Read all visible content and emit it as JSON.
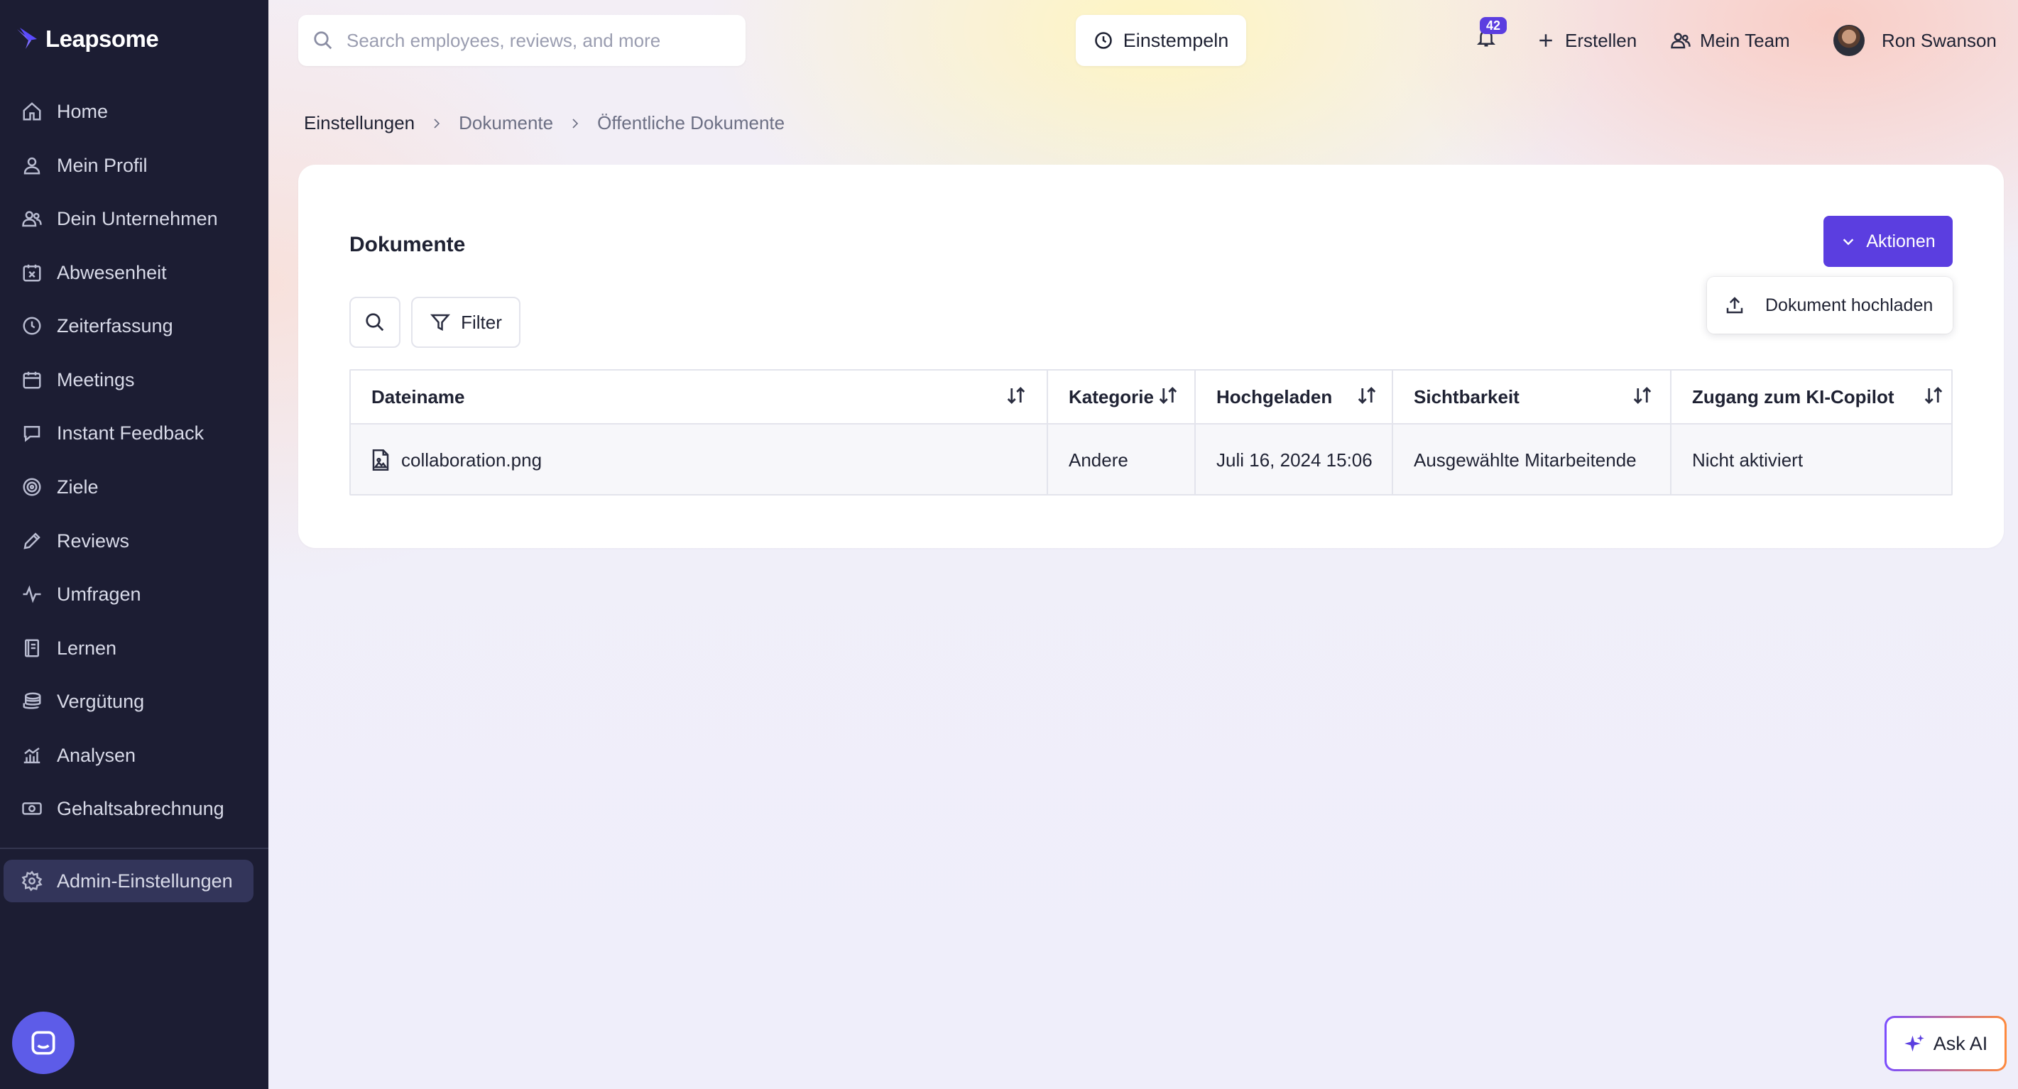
{
  "app": {
    "brand": "Leapsome"
  },
  "sidebar": {
    "items": [
      {
        "label": "Home",
        "icon": "home-icon"
      },
      {
        "label": "Mein Profil",
        "icon": "user-icon"
      },
      {
        "label": "Dein Unternehmen",
        "icon": "users-icon"
      },
      {
        "label": "Abwesenheit",
        "icon": "calendar-x-icon"
      },
      {
        "label": "Zeiterfassung",
        "icon": "clock-icon"
      },
      {
        "label": "Meetings",
        "icon": "calendar-icon"
      },
      {
        "label": "Instant Feedback",
        "icon": "chat-icon"
      },
      {
        "label": "Ziele",
        "icon": "target-icon"
      },
      {
        "label": "Reviews",
        "icon": "pencil-icon"
      },
      {
        "label": "Umfragen",
        "icon": "pulse-icon"
      },
      {
        "label": "Lernen",
        "icon": "book-icon"
      },
      {
        "label": "Vergütung",
        "icon": "coins-icon"
      },
      {
        "label": "Analysen",
        "icon": "chart-icon"
      },
      {
        "label": "Gehaltsabrechnung",
        "icon": "money-icon"
      }
    ],
    "admin": {
      "label": "Admin-Einstellungen",
      "icon": "gear-icon"
    }
  },
  "topbar": {
    "search_placeholder": "Search employees, reviews, and more",
    "clockin_label": "Einstempeln",
    "notifications_count": "42",
    "create_label": "Erstellen",
    "team_label": "Mein Team",
    "user_name": "Ron Swanson"
  },
  "breadcrumb": [
    "Einstellungen",
    "Dokumente",
    "Öffentliche Dokumente"
  ],
  "card": {
    "title": "Dokumente",
    "actions_label": "Aktionen",
    "dropdown_item": "Dokument hochladen",
    "filter_label": "Filter"
  },
  "table": {
    "columns": [
      "Dateiname",
      "Kategorie",
      "Hochgeladen",
      "Sichtbarkeit",
      "Zugang zum KI-Copilot"
    ],
    "rows": [
      [
        "collaboration.png",
        "Andere",
        "Juli 16, 2024 15:06",
        "Ausgewählte Mitarbeitende",
        "Nicht aktiviert"
      ]
    ]
  },
  "ask_ai": {
    "label": "Ask AI"
  },
  "colors": {
    "accent": "#5b3ee0",
    "sidebar_bg": "#1c1d33"
  }
}
